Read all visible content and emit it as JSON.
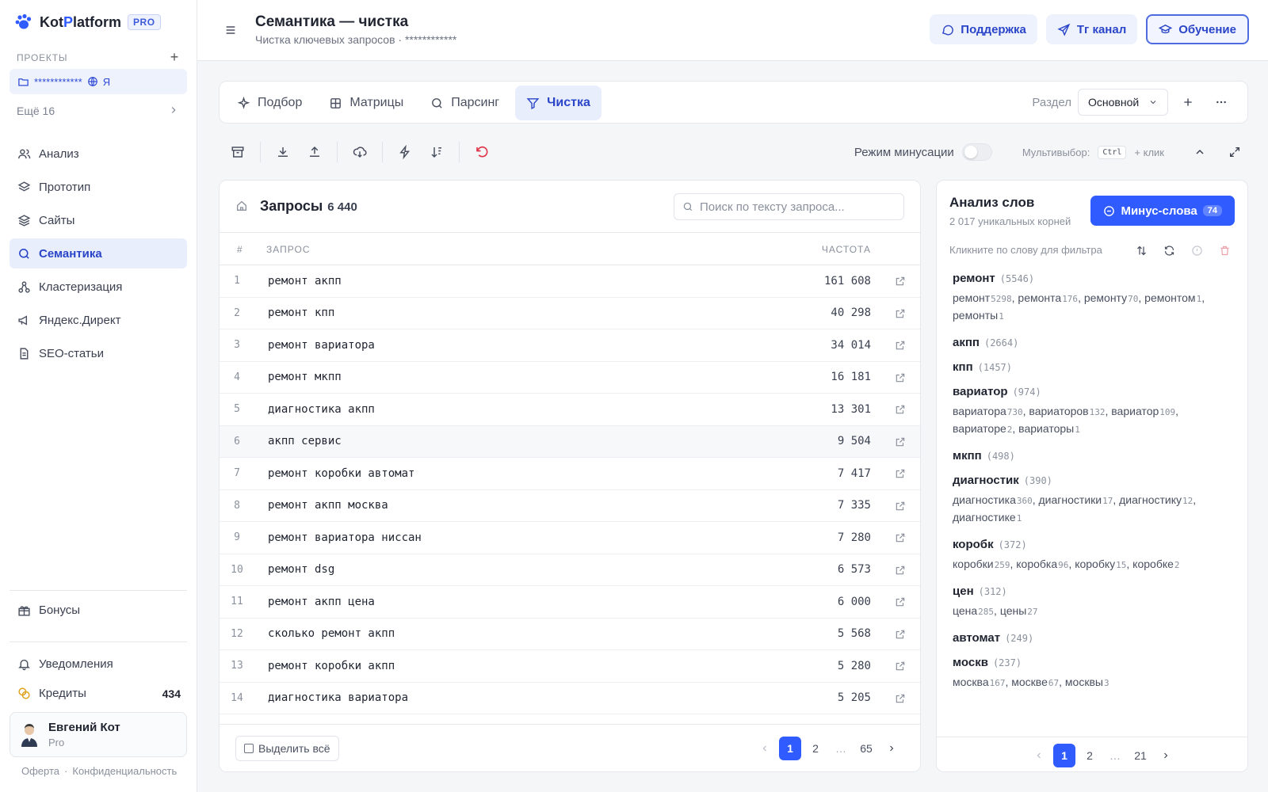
{
  "brand": {
    "name_prefix": "Kot",
    "name_accent": "P",
    "name_suffix": "latform",
    "badge": "PRO"
  },
  "sidebar": {
    "projects_header": "ПРОЕКТЫ",
    "add_icon": "plus-icon",
    "project": {
      "name": "************",
      "suffix": "Я"
    },
    "more_projects": "Ещё 16",
    "nav": [
      {
        "label": "Анализ",
        "icon": "users-icon"
      },
      {
        "label": "Прототип",
        "icon": "layers-icon"
      },
      {
        "label": "Сайты",
        "icon": "stack-icon"
      },
      {
        "label": "Семантика",
        "icon": "search-icon",
        "active": true
      },
      {
        "label": "Кластеризация",
        "icon": "cluster-icon"
      },
      {
        "label": "Яндекс.Директ",
        "icon": "megaphone-icon"
      },
      {
        "label": "SEO-статьи",
        "icon": "document-icon"
      }
    ],
    "bonuses": "Бонусы",
    "notifications": "Уведомления",
    "credits_label": "Кредиты",
    "credits_value": "434",
    "user": {
      "name": "Евгений Кот",
      "plan": "Pro"
    },
    "footer": {
      "offer": "Оферта",
      "sep": "·",
      "privacy": "Конфиденциальность"
    }
  },
  "header": {
    "title": "Семантика — чистка",
    "subtitle": "Чистка ключевых запросов · ************",
    "buttons": {
      "support": "Поддержка",
      "telegram": "Тг канал",
      "learning": "Обучение"
    }
  },
  "tabs": [
    {
      "label": "Подбор",
      "icon": "sparkle-icon"
    },
    {
      "label": "Матрицы",
      "icon": "grid-icon"
    },
    {
      "label": "Парсинг",
      "icon": "search-icon"
    },
    {
      "label": "Чистка",
      "icon": "filter-icon",
      "active": true
    }
  ],
  "section": {
    "label": "Раздел",
    "value": "Основной"
  },
  "toolbar": {
    "minus_mode_label": "Режим минусации",
    "minus_mode_on": false,
    "multi_label": "Мультивыбор:",
    "multi_key": "Ctrl",
    "multi_click": "+ клик"
  },
  "queries": {
    "title": "Запросы",
    "count": "6 440",
    "search_placeholder": "Поиск по тексту запроса...",
    "columns": {
      "num": "#",
      "query": "ЗАПРОС",
      "freq": "ЧАСТОТА"
    },
    "rows": [
      {
        "n": "1",
        "q": "ремонт акпп",
        "f": "161 608"
      },
      {
        "n": "2",
        "q": "ремонт кпп",
        "f": "40 298"
      },
      {
        "n": "3",
        "q": "ремонт вариатора",
        "f": "34 014"
      },
      {
        "n": "4",
        "q": "ремонт мкпп",
        "f": "16 181"
      },
      {
        "n": "5",
        "q": "диагностика акпп",
        "f": "13 301"
      },
      {
        "n": "6",
        "q": "акпп сервис",
        "f": "9 504"
      },
      {
        "n": "7",
        "q": "ремонт коробки автомат",
        "f": "7 417"
      },
      {
        "n": "8",
        "q": "ремонт акпп москва",
        "f": "7 335"
      },
      {
        "n": "9",
        "q": "ремонт вариатора ниссан",
        "f": "7 280"
      },
      {
        "n": "10",
        "q": "ремонт dsg",
        "f": "6 573"
      },
      {
        "n": "11",
        "q": "ремонт акпп цена",
        "f": "6 000"
      },
      {
        "n": "12",
        "q": "сколько ремонт акпп",
        "f": "5 568"
      },
      {
        "n": "13",
        "q": "ремонт коробки акпп",
        "f": "5 280"
      },
      {
        "n": "14",
        "q": "диагностика вариатора",
        "f": "5 205"
      }
    ],
    "select_all": "Выделить всё",
    "pager": {
      "pages": [
        "1",
        "2",
        "…",
        "65"
      ],
      "current": "1"
    }
  },
  "words": {
    "title": "Анализ слов",
    "subtitle": "2 017 уникальных корней",
    "minus_button": "Минус-слова",
    "minus_count": "74",
    "hint": "Кликните по слову для фильтра",
    "roots": [
      {
        "name": "ремонт",
        "count": "(5546)",
        "forms": [
          [
            "ремонт",
            "5298"
          ],
          [
            "ремонта",
            "176"
          ],
          [
            "ремонту",
            "70"
          ],
          [
            "ремонтом",
            "1"
          ],
          [
            "ремонты",
            "1"
          ]
        ]
      },
      {
        "name": "акпп",
        "count": "(2664)",
        "forms": []
      },
      {
        "name": "кпп",
        "count": "(1457)",
        "forms": []
      },
      {
        "name": "вариатор",
        "count": "(974)",
        "forms": [
          [
            "вариатора",
            "730"
          ],
          [
            "вариаторов",
            "132"
          ],
          [
            "вариатор",
            "109"
          ],
          [
            "вариаторе",
            "2"
          ],
          [
            "вариаторы",
            "1"
          ]
        ]
      },
      {
        "name": "мкпп",
        "count": "(498)",
        "forms": []
      },
      {
        "name": "диагностик",
        "count": "(390)",
        "forms": [
          [
            "диагностика",
            "360"
          ],
          [
            "диагностики",
            "17"
          ],
          [
            "диагностику",
            "12"
          ],
          [
            "диагностике",
            "1"
          ]
        ]
      },
      {
        "name": "коробк",
        "count": "(372)",
        "forms": [
          [
            "коробки",
            "259"
          ],
          [
            "коробка",
            "96"
          ],
          [
            "коробку",
            "15"
          ],
          [
            "коробке",
            "2"
          ]
        ]
      },
      {
        "name": "цен",
        "count": "(312)",
        "forms": [
          [
            "цена",
            "285"
          ],
          [
            "цены",
            "27"
          ]
        ]
      },
      {
        "name": "автомат",
        "count": "(249)",
        "forms": []
      },
      {
        "name": "москв",
        "count": "(237)",
        "forms": [
          [
            "москва",
            "167"
          ],
          [
            "москве",
            "67"
          ],
          [
            "москвы",
            "3"
          ]
        ]
      }
    ],
    "pager": {
      "pages": [
        "1",
        "2",
        "…",
        "21"
      ],
      "current": "1"
    }
  },
  "colors": {
    "accent": "#2f5bff",
    "accent_soft": "#e9eefc",
    "danger": "#e0364a"
  }
}
